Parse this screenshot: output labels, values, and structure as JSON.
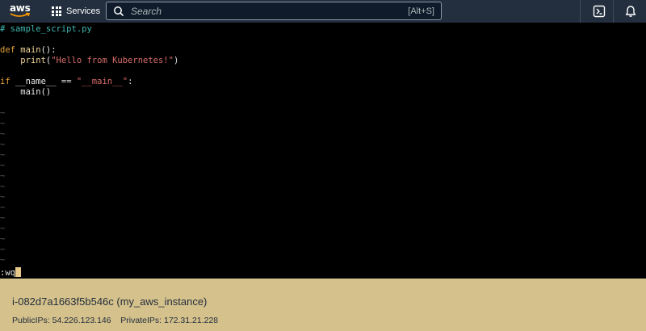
{
  "topbar": {
    "logo_text": "aws",
    "services_label": "Services",
    "search_placeholder": "Search",
    "search_shortcut": "[Alt+S]",
    "icons": [
      "cloudshell-icon",
      "notifications-bell-icon"
    ],
    "colors": {
      "bar": "#232f3e",
      "accent": "#ff9900"
    }
  },
  "terminal": {
    "lines": [
      {
        "kind": "comment",
        "text": "# sample_script.py"
      },
      {
        "kind": "blank",
        "text": ""
      },
      {
        "kind": "def",
        "keyword": "def",
        "name": "main",
        "rest": "():"
      },
      {
        "kind": "call",
        "indent": "    ",
        "func": "print",
        "open": "(",
        "string": "\"Hello from Kubernetes!\"",
        "close": ")"
      },
      {
        "kind": "blank",
        "text": ""
      },
      {
        "kind": "if",
        "keyword": "if",
        "pre": " __name__ == ",
        "string": "\"__main__\"",
        "post": ":"
      },
      {
        "kind": "plain",
        "text": "    main()"
      }
    ],
    "tilde_char": "~",
    "tilde_count": 15,
    "command": ":wq"
  },
  "instance": {
    "title": "i-082d7a1663f5b546c (my_aws_instance)",
    "public_ips_label": "PublicIPs:",
    "public_ips": "54.226.123.146",
    "private_ips_label": "PrivateIPs:",
    "private_ips": "172.31.21.228"
  }
}
